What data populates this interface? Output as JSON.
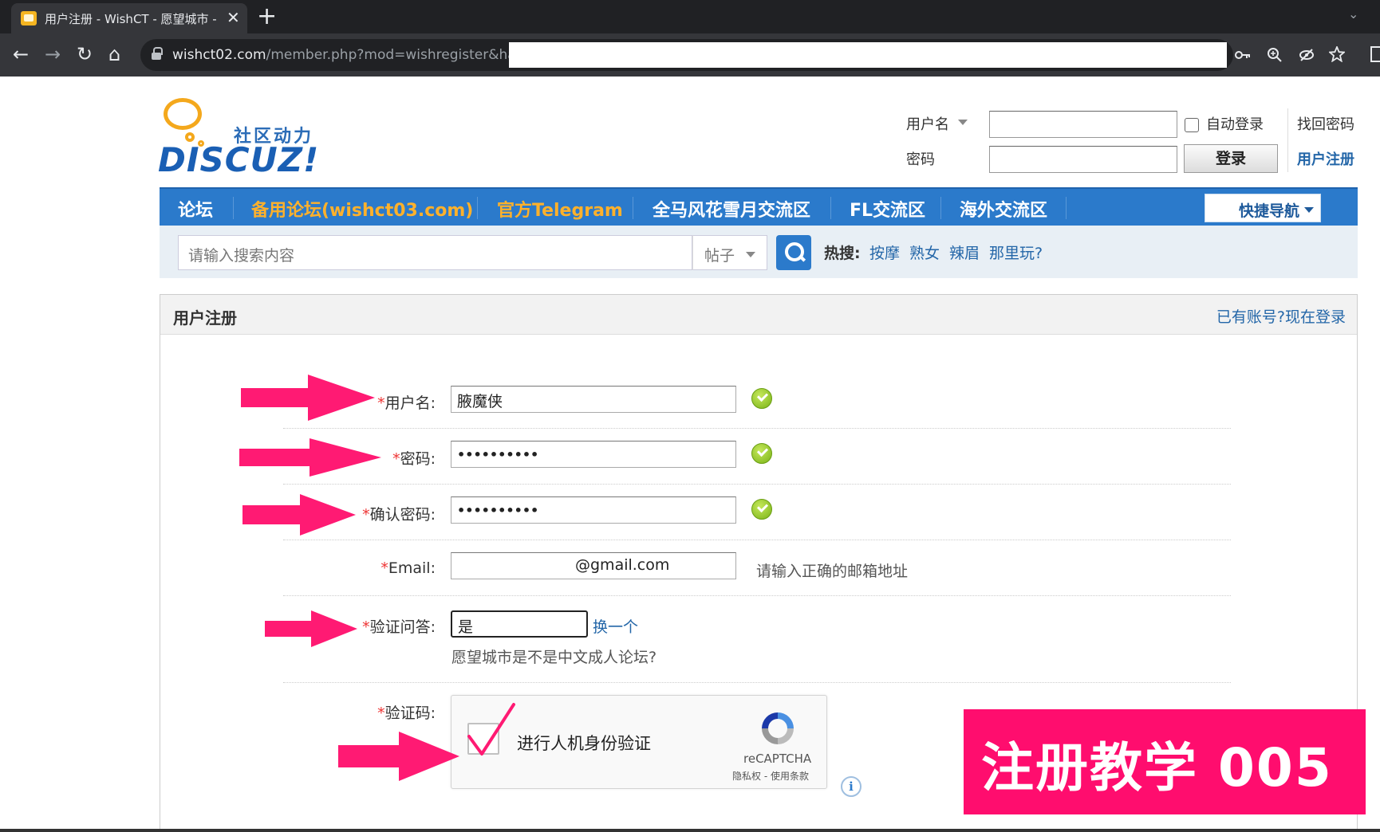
{
  "browser": {
    "tab_title": "用户注册 - WishCT - 愿望城市 - P",
    "tab_close": "✕",
    "new_tab": "+",
    "window_control": "⌄",
    "url_host": "wishct02.com",
    "url_path": "/member.php?mod=wishregister&hash=",
    "back": "←",
    "forward": "→",
    "reload": "↻",
    "home": "⌂"
  },
  "logo": {
    "tagline": "社区动力",
    "brand": "DISCUZ!"
  },
  "login": {
    "username_label": "用户名",
    "password_label": "密码",
    "auto_login_label": "自动登录",
    "login_button": "登录",
    "find_password": "找回密码",
    "register": "用户注册"
  },
  "nav": {
    "items": [
      {
        "label": "论坛",
        "highlight": false
      },
      {
        "label": "备用论坛(wishct03.com)",
        "highlight": true
      },
      {
        "label": "官方Telegram",
        "highlight": true
      },
      {
        "label": "全马风花雪月交流区",
        "highlight": false
      },
      {
        "label": "FL交流区",
        "highlight": false
      },
      {
        "label": "海外交流区",
        "highlight": false
      }
    ],
    "quick_nav": "快捷导航"
  },
  "search": {
    "placeholder": "请输入搜索内容",
    "type": "帖子",
    "hot_label": "热搜:",
    "hot_links": [
      "按摩",
      "熟女",
      "辣眉",
      "那里玩?"
    ]
  },
  "register": {
    "title": "用户注册",
    "login_link": "已有账号?现在登录",
    "required_mark": "*",
    "fields": {
      "username": {
        "label": "用户名:",
        "value": "腋魔侠"
      },
      "password": {
        "label": "密码:",
        "value": "••••••••••"
      },
      "confirm": {
        "label": "确认密码:",
        "value": "••••••••••"
      },
      "email": {
        "label": "Email:",
        "value": "@gmail.com",
        "hint": "请输入正确的邮箱地址"
      },
      "question": {
        "label": "验证问答:",
        "value": "是",
        "change_link": "换一个",
        "question_text": "愿望城市是不是中文成人论坛?"
      },
      "captcha": {
        "label": "验证码:"
      }
    },
    "recaptcha": {
      "label": "进行人机身份验证",
      "brand": "reCAPTCHA",
      "terms": "隐私权 - 使用条款",
      "info": "i"
    }
  },
  "banner": {
    "text": "注册教学 005"
  },
  "colors": {
    "nav_blue": "#2b7acb",
    "link_blue": "#2366a8",
    "nav_highlight": "#ffb12b",
    "arrow_pink": "#ff1a73",
    "banner_pink": "#ff0d6e",
    "required_red": "#e33"
  }
}
